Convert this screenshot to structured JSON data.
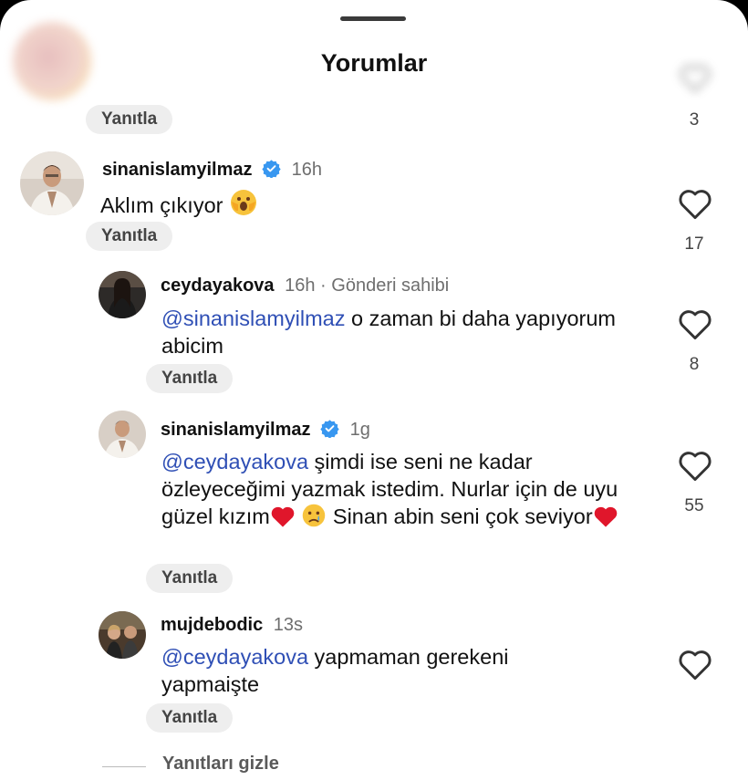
{
  "sheet": {
    "title": "Yorumlar"
  },
  "top_comment": {
    "reply_label": "Yanıtla",
    "like_count": "3"
  },
  "comments": [
    {
      "username": "sinanislamyilmaz",
      "verified": true,
      "time": "16h",
      "text": "Aklım çıkıyor",
      "emoji": "shocked-face-icon",
      "reply_label": "Yanıtla",
      "like_count": "17"
    },
    {
      "username": "ceydayakova",
      "time": "16h",
      "owner_label": "· Gönderi sahibi",
      "mention": "@sinanislamyilmaz",
      "text_after": " o zaman bi daha yapıyorum abicim",
      "reply_label": "Yanıtla",
      "like_count": "8"
    },
    {
      "username": "sinanislamyilmaz",
      "verified": true,
      "time": "1g",
      "mention": "@ceydayakova",
      "text_part1": " şimdi ise seni ne kadar özleyeceğimi yazmak istedim. Nurlar için de uyu güzel kızım",
      "text_part2": " Sinan abin seni çok seviyor",
      "reply_label": "Yanıtla",
      "like_count": "55"
    },
    {
      "username": "mujdebodic",
      "time": "13s",
      "mention": "@ceydayakova",
      "text_after": " yapmaman gerekeni yapmaişte",
      "reply_label": "Yanıtla",
      "like_count": ""
    }
  ],
  "hide_replies_label": "Yanıtları gizle",
  "colors": {
    "mention": "#2f4fb5",
    "verified": "#3897f0",
    "heart": "#e0162b"
  }
}
